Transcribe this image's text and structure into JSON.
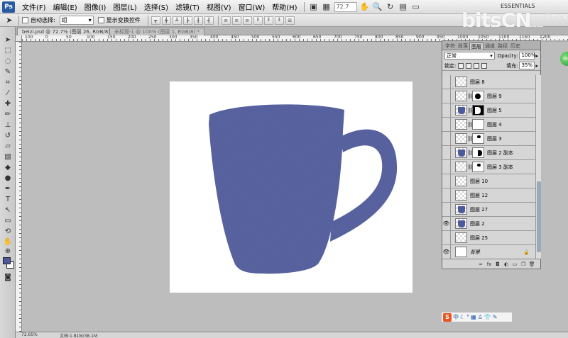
{
  "app": {
    "logo": "Ps",
    "workspace": "ESSENTIALS",
    "zoom_field": "72.7"
  },
  "menu": [
    {
      "name": "file",
      "label": "文件(F)"
    },
    {
      "name": "edit",
      "label": "编辑(E)"
    },
    {
      "name": "image",
      "label": "图像(I)"
    },
    {
      "name": "layer",
      "label": "图层(L)"
    },
    {
      "name": "select",
      "label": "选择(S)"
    },
    {
      "name": "filter",
      "label": "滤镜(T)"
    },
    {
      "name": "view",
      "label": "视图(V)"
    },
    {
      "name": "window",
      "label": "窗口(W)"
    },
    {
      "name": "help",
      "label": "帮助(H)"
    }
  ],
  "options": {
    "auto_select_label": "自动选择:",
    "auto_select_value": "组",
    "show_transform_label": "显示变换控件"
  },
  "watermark": {
    "main": "bitsCN",
    "tld": ".com",
    "sub": "网管之家"
  },
  "document_tabs": [
    {
      "label": "beizi.psd @ 72.7% (图层 26, RGB/8) *",
      "active": true
    },
    {
      "label": "未标题-1 @ 100% (图层 1, RGB/8) *",
      "active": false
    }
  ],
  "ruler": {
    "h_ticks": [
      "100",
      "0",
      "50",
      "100",
      "150",
      "200",
      "250",
      "300",
      "350",
      "400",
      "450",
      "500",
      "550",
      "600",
      "650",
      "700",
      "750",
      "800",
      "850",
      "900",
      "950",
      "1000",
      "1050",
      "1100",
      "1150",
      "1200"
    ]
  },
  "layers_panel": {
    "tabs": [
      "字符",
      "段落",
      "图层",
      "通道",
      "路径",
      "历史"
    ],
    "blend_mode": "正常",
    "opacity_label": "Opacity:",
    "opacity_value": "100%",
    "lock_label": "锁定:",
    "fill_label": "填充:",
    "fill_value": "35%",
    "layers": [
      {
        "name": "图层 8",
        "visible": false,
        "thumb": "transparent",
        "mask": null
      },
      {
        "name": "图层 9",
        "visible": false,
        "thumb": "transparent",
        "mask": "m9"
      },
      {
        "name": "图层 5",
        "visible": false,
        "thumb": "cup",
        "mask": "m5"
      },
      {
        "name": "图层 4",
        "visible": false,
        "thumb": "transparent",
        "mask": "plain"
      },
      {
        "name": "图层 3",
        "visible": false,
        "thumb": "transparent",
        "mask": "m3"
      },
      {
        "name": "图层 2 副本",
        "visible": false,
        "thumb": "cup",
        "mask": "m2c"
      },
      {
        "name": "图层 3 副本",
        "visible": false,
        "thumb": "transparent",
        "mask": "m3"
      },
      {
        "name": "图层 10",
        "visible": false,
        "thumb": "transparent",
        "mask": null
      },
      {
        "name": "图层 12",
        "visible": false,
        "thumb": "transparent",
        "mask": null
      },
      {
        "name": "图层 27",
        "visible": false,
        "thumb": "cup",
        "mask": null
      },
      {
        "name": "图层 2",
        "visible": true,
        "thumb": "cup",
        "mask": null
      },
      {
        "name": "图层 25",
        "visible": false,
        "thumb": "transparent",
        "mask": null
      },
      {
        "name": "背景",
        "visible": true,
        "thumb": "white",
        "mask": null,
        "locked": true
      }
    ]
  },
  "green_tab_label": "39",
  "ime": {
    "logo": "S",
    "lang": "中"
  },
  "status": {
    "zoom": "72.65%",
    "doc": "文档:1.81M/38.1M"
  },
  "colors": {
    "cup": "#4d5a9a",
    "canvas_bg": "#ffffff",
    "workspace": "#bdbdbd"
  }
}
